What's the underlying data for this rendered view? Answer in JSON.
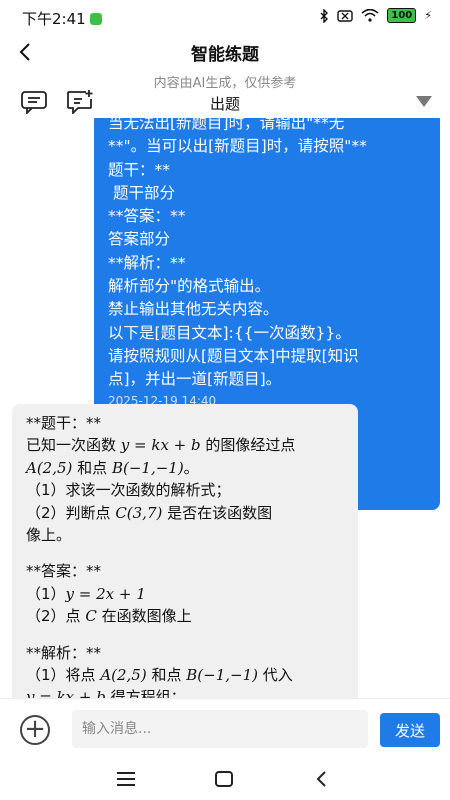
{
  "status_bar": {
    "time": "下午2:41",
    "battery": "100"
  },
  "header": {
    "title": "智能练题",
    "disclaimer": "内容由AI生成，仅供参考",
    "mode": "出题"
  },
  "user_message": {
    "lines": [
      "当无法出[新题目]时，请输出\"**无",
      "**\"。当可以出[新题目]时，请按照\"**",
      "题干：**",
      " 题干部分",
      "**答案：**",
      "答案部分",
      "**解析：**",
      "解析部分\"的格式输出。",
      "禁止输出其他无关内容。",
      "以下是[题目文本]:{{一次函数}}。",
      "请按照规则从[题目文本]中提取[知识",
      "点]，并出一道[新题目]。"
    ],
    "timestamp": "2025-12-19 14:40"
  },
  "ai_message": {
    "q_label": "**题干：**",
    "q1a": "已知一次函数 ",
    "q1m": "y = kx + b",
    "q1b": " 的图像经过点",
    "q2m1": "A(2,5)",
    "q2a": " 和点 ",
    "q2m2": "B(−1,−1)",
    "q2b": "。",
    "q3": "（1）求该一次函数的解析式；",
    "q4a": "（2）判断点 ",
    "q4m": "C(3,7)",
    "q4b": " 是否在该函数图",
    "q5": "像上。",
    "a_label": "**答案：**",
    "a1a": "（1）",
    "a1m": "y = 2x + 1",
    "a2a": "（2）点 ",
    "a2m": "C",
    "a2b": " 在函数图像上",
    "e_label": "**解析：**",
    "e1a": "（1）将点 ",
    "e1m1": "A(2,5)",
    "e1b": " 和点 ",
    "e1m2": "B(−1,−1)",
    "e1c": " 代入",
    "e2m": "y = kx + b",
    "e2a": " 得方程组："
  },
  "input": {
    "placeholder": "输入消息...",
    "value": ""
  },
  "send_label": "发送",
  "colors": {
    "accent": "#1e7be8",
    "ai_bubble": "#f0f0f0"
  }
}
